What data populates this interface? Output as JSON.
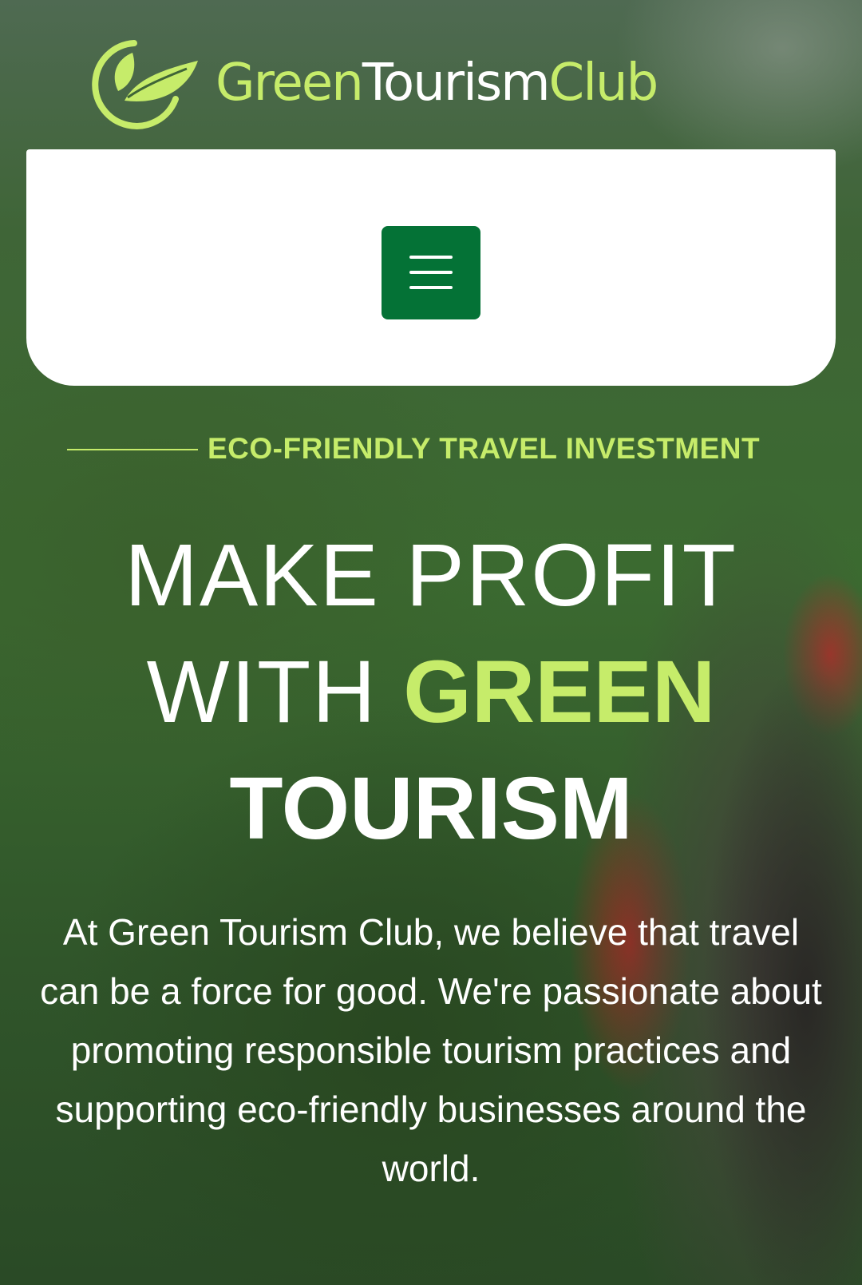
{
  "brand": {
    "logo_part1": "Green",
    "logo_part2": "Tourism",
    "logo_part3": "Club",
    "accent_color": "#c6ec6a",
    "button_color": "#047236",
    "logo_icon": "leaf-circle-icon"
  },
  "nav": {
    "menu_icon": "hamburger-menu-icon"
  },
  "hero": {
    "eyebrow": "ECO-FRIENDLY TRAVEL INVESTMENT",
    "headline_line1": "MAKE PROFIT",
    "headline_with": "WITH ",
    "headline_green": "GREEN",
    "headline_line3": "TOURISM",
    "body": "At Green Tourism Club, we believe that travel can be a force for good. We're passionate about promoting responsible tourism practices and supporting eco-friendly businesses around the world."
  }
}
